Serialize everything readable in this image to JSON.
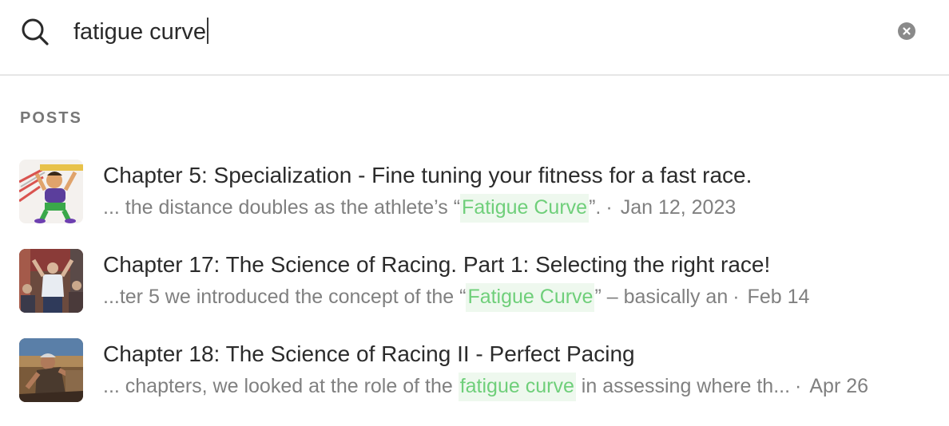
{
  "search": {
    "query": "fatigue curve",
    "placeholder": "Search"
  },
  "section": {
    "label": "POSTS"
  },
  "results": [
    {
      "title": "Chapter 5: Specialization - Fine tuning your fitness for a fast race.",
      "snippet_before": "... the distance doubles as the athlete’s “",
      "snippet_match": "Fatigue Curve",
      "snippet_after": "”.",
      "date": "Jan 12, 2023"
    },
    {
      "title": "Chapter 17: The Science of Racing. Part 1: Selecting the right race!",
      "snippet_before": "...ter 5 we introduced the concept of the “",
      "snippet_match": "Fatigue Curve",
      "snippet_after": "” – basically an",
      "date": "Feb 14"
    },
    {
      "title": "Chapter 18: The Science of Racing II - Perfect Pacing",
      "snippet_before": "... chapters, we looked at the role of the ",
      "snippet_match": "fatigue curve",
      "snippet_after": " in assessing where th...",
      "date": "Apr 26"
    }
  ],
  "separator": "·",
  "colors": {
    "highlight_text": "#6fcf7a",
    "highlight_bg": "#eef8ee",
    "divider": "#e6e6e6"
  }
}
